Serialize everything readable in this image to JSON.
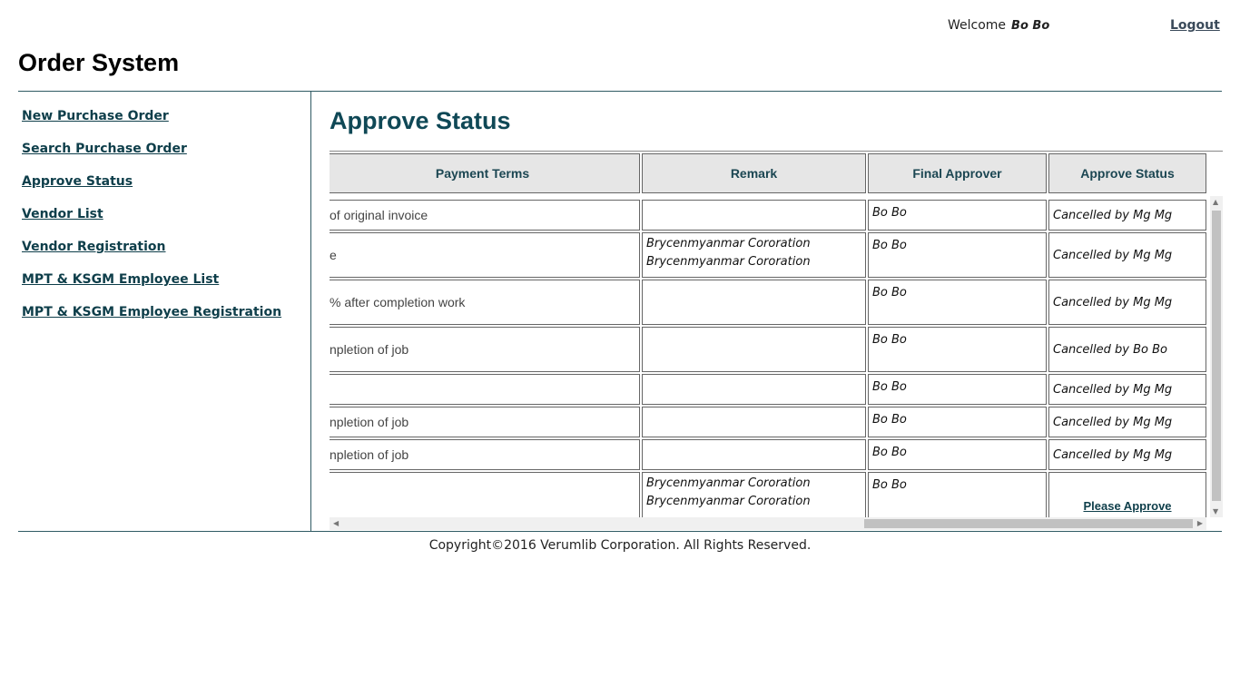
{
  "header": {
    "title": "Order System",
    "welcome_label": "Welcome",
    "user": "Bo Bo",
    "logout": "Logout"
  },
  "sidebar": {
    "items": [
      {
        "label": "New Purchase Order"
      },
      {
        "label": "Search Purchase Order"
      },
      {
        "label": "Approve Status"
      },
      {
        "label": "Vendor List"
      },
      {
        "label": "Vendor Registration"
      },
      {
        "label": "MPT & KSGM Employee List"
      },
      {
        "label": "MPT & KSGM Employee Registration"
      }
    ]
  },
  "main": {
    "title": "Approve Status",
    "columns": [
      "Payment Terms",
      "Remark",
      "Final Approver",
      "Approve Status"
    ],
    "rows": [
      {
        "payment": "of original invoice",
        "remark": [
          "",
          ""
        ],
        "approver": "Bo Bo",
        "status": "Cancelled by Mg Mg"
      },
      {
        "payment": "e",
        "remark": [
          "Brycenmyanmar Cororation",
          "Brycenmyanmar Cororation"
        ],
        "approver": "Bo Bo",
        "status": "Cancelled by Mg Mg"
      },
      {
        "payment": "% after completion work",
        "remark": [
          "",
          ""
        ],
        "approver": "Bo Bo",
        "status": "Cancelled by Mg Mg"
      },
      {
        "payment": "npletion of job",
        "remark": [
          "",
          ""
        ],
        "approver": "Bo Bo",
        "status": "Cancelled by Bo Bo"
      },
      {
        "payment": "",
        "remark": [
          "",
          ""
        ],
        "approver": "Bo Bo",
        "status": "Cancelled by Mg Mg"
      },
      {
        "payment": "npletion of job",
        "remark": [
          "",
          ""
        ],
        "approver": "Bo Bo",
        "status": "Cancelled by Mg Mg"
      },
      {
        "payment": "npletion of job",
        "remark": [
          "",
          ""
        ],
        "approver": "Bo Bo",
        "status": "Cancelled by Mg Mg"
      },
      {
        "payment": "",
        "remark": [
          "Brycenmyanmar Cororation",
          "Brycenmyanmar Cororation"
        ],
        "approver": "Bo Bo",
        "status": "Please Approve"
      }
    ]
  },
  "footer": {
    "copyright": "Copyright©2016 Verumlib Corporation. All Rights Reserved."
  }
}
